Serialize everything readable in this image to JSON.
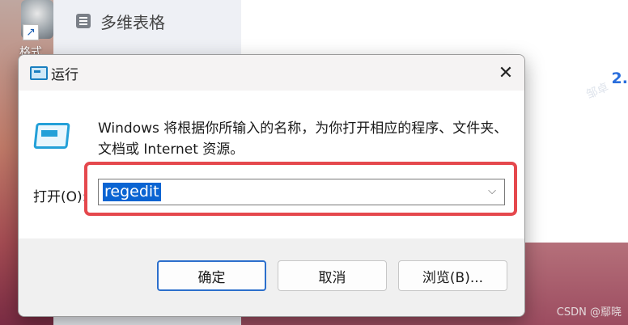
{
  "background": {
    "desktop_icon_label": "格式",
    "sidebar_item": "多维表格",
    "main_number": "2.",
    "main_watermark": "邹卓",
    "csdn_watermark": "CSDN @鄢晓"
  },
  "dialog": {
    "title": "运行",
    "close_glyph": "✕",
    "description": "Windows 将根据你所输入的名称，为你打开相应的程序、文件夹、文档或 Internet 资源。",
    "open_label": "打开(O):",
    "open_value": "regedit",
    "dropdown_glyph": "⌵",
    "buttons": {
      "ok": "确定",
      "cancel": "取消",
      "browse": "浏览(B)..."
    }
  },
  "colors": {
    "accent_blue": "#0a64d2",
    "highlight_red": "#e5484d",
    "ok_border": "#2c6fcc"
  },
  "icons": {
    "title": "run-icon",
    "content": "run-icon",
    "close": "close-icon",
    "dropdown": "chevron-down-icon"
  }
}
